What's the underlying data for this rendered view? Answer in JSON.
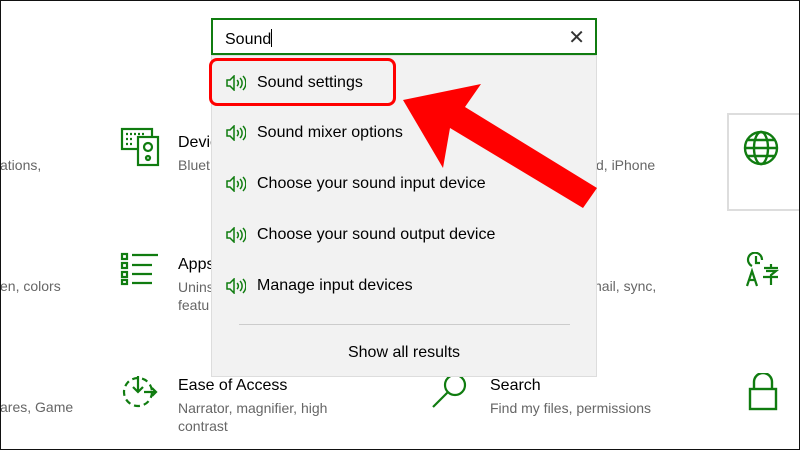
{
  "search": {
    "value": "Sound",
    "clear_icon": "close-icon"
  },
  "results": [
    {
      "label": "Sound settings",
      "icon": "speaker-icon"
    },
    {
      "label": "Sound mixer options",
      "icon": "speaker-icon"
    },
    {
      "label": "Choose your sound input device",
      "icon": "speaker-icon"
    },
    {
      "label": "Choose your sound output device",
      "icon": "speaker-icon"
    },
    {
      "label": "Manage input devices",
      "icon": "speaker-icon"
    }
  ],
  "show_all": "Show all results",
  "background": {
    "left_desc": [
      "ations,",
      "en, colors",
      "ares, Game"
    ],
    "devices": {
      "title": "Devic",
      "desc": "Bluet"
    },
    "apps": {
      "title": "Apps",
      "desc1": "Unins",
      "desc2": "featu"
    },
    "ease": {
      "title": "Ease of Access",
      "desc1": "Narrator, magnifier, high",
      "desc2": "contrast"
    },
    "search_tile": {
      "title": "Search",
      "desc": "Find my files, permissions"
    },
    "right_desc": [
      "d, iPhone",
      "nail, sync,"
    ]
  },
  "colors": {
    "accent": "#107c10",
    "highlight": "#ff0000"
  }
}
